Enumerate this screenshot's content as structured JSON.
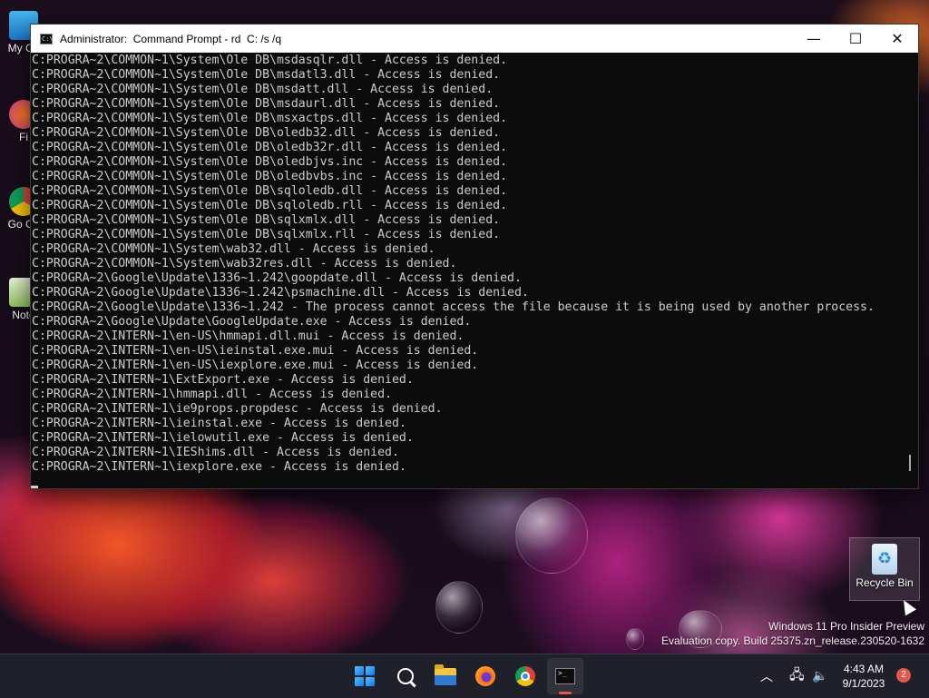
{
  "window": {
    "title": "Administrator:  Command Prompt - rd  C: /s /q",
    "minimize_glyph": "—",
    "maximize_glyph": "☐",
    "close_glyph": "✕",
    "app_icon": "cmd-icon"
  },
  "console": {
    "lines": [
      "C:PROGRA~2\\COMMON~1\\System\\Ole DB\\msdasqlr.dll - Access is denied.",
      "C:PROGRA~2\\COMMON~1\\System\\Ole DB\\msdatl3.dll - Access is denied.",
      "C:PROGRA~2\\COMMON~1\\System\\Ole DB\\msdatt.dll - Access is denied.",
      "C:PROGRA~2\\COMMON~1\\System\\Ole DB\\msdaurl.dll - Access is denied.",
      "C:PROGRA~2\\COMMON~1\\System\\Ole DB\\msxactps.dll - Access is denied.",
      "C:PROGRA~2\\COMMON~1\\System\\Ole DB\\oledb32.dll - Access is denied.",
      "C:PROGRA~2\\COMMON~1\\System\\Ole DB\\oledb32r.dll - Access is denied.",
      "C:PROGRA~2\\COMMON~1\\System\\Ole DB\\oledbjvs.inc - Access is denied.",
      "C:PROGRA~2\\COMMON~1\\System\\Ole DB\\oledbvbs.inc - Access is denied.",
      "C:PROGRA~2\\COMMON~1\\System\\Ole DB\\sqloledb.dll - Access is denied.",
      "C:PROGRA~2\\COMMON~1\\System\\Ole DB\\sqloledb.rll - Access is denied.",
      "C:PROGRA~2\\COMMON~1\\System\\Ole DB\\sqlxmlx.dll - Access is denied.",
      "C:PROGRA~2\\COMMON~1\\System\\Ole DB\\sqlxmlx.rll - Access is denied.",
      "C:PROGRA~2\\COMMON~1\\System\\wab32.dll - Access is denied.",
      "C:PROGRA~2\\COMMON~1\\System\\wab32res.dll - Access is denied.",
      "C:PROGRA~2\\Google\\Update\\1336~1.242\\goopdate.dll - Access is denied.",
      "C:PROGRA~2\\Google\\Update\\1336~1.242\\psmachine.dll - Access is denied.",
      "C:PROGRA~2\\Google\\Update\\1336~1.242 - The process cannot access the file because it is being used by another process.",
      "C:PROGRA~2\\Google\\Update\\GoogleUpdate.exe - Access is denied.",
      "C:PROGRA~2\\INTERN~1\\en-US\\hmmapi.dll.mui - Access is denied.",
      "C:PROGRA~2\\INTERN~1\\en-US\\ieinstal.exe.mui - Access is denied.",
      "C:PROGRA~2\\INTERN~1\\en-US\\iexplore.exe.mui - Access is denied.",
      "C:PROGRA~2\\INTERN~1\\ExtExport.exe - Access is denied.",
      "C:PROGRA~2\\INTERN~1\\hmmapi.dll - Access is denied.",
      "C:PROGRA~2\\INTERN~1\\ie9props.propdesc - Access is denied.",
      "C:PROGRA~2\\INTERN~1\\ieinstal.exe - Access is denied.",
      "C:PROGRA~2\\INTERN~1\\ielowutil.exe - Access is denied.",
      "C:PROGRA~2\\INTERN~1\\IEShims.dll - Access is denied.",
      "C:PROGRA~2\\INTERN~1\\iexplore.exe - Access is denied."
    ]
  },
  "desktop": {
    "icons": [
      {
        "label": "My Co",
        "icon": "computer-icon"
      },
      {
        "label": "Fi",
        "icon": "firefox-shortcut-icon"
      },
      {
        "label": "Go Ch",
        "icon": "chrome-shortcut-icon"
      },
      {
        "label": "Note",
        "icon": "notepad-shortcut-icon"
      }
    ],
    "recycle_bin": "Recycle Bin",
    "watermark_line1": "Windows 11 Pro Insider Preview",
    "watermark_line2": "Evaluation copy. Build 25375.zn_release.230520-1632"
  },
  "taskbar": {
    "apps": [
      "start-icon",
      "search-icon",
      "file-explorer-icon",
      "firefox-icon",
      "chrome-icon",
      "command-prompt-icon"
    ],
    "active_app": "command-prompt-icon",
    "tray_chevron": "︿",
    "time": "4:43 AM",
    "date": "9/1/2023",
    "notification_count": "2"
  }
}
